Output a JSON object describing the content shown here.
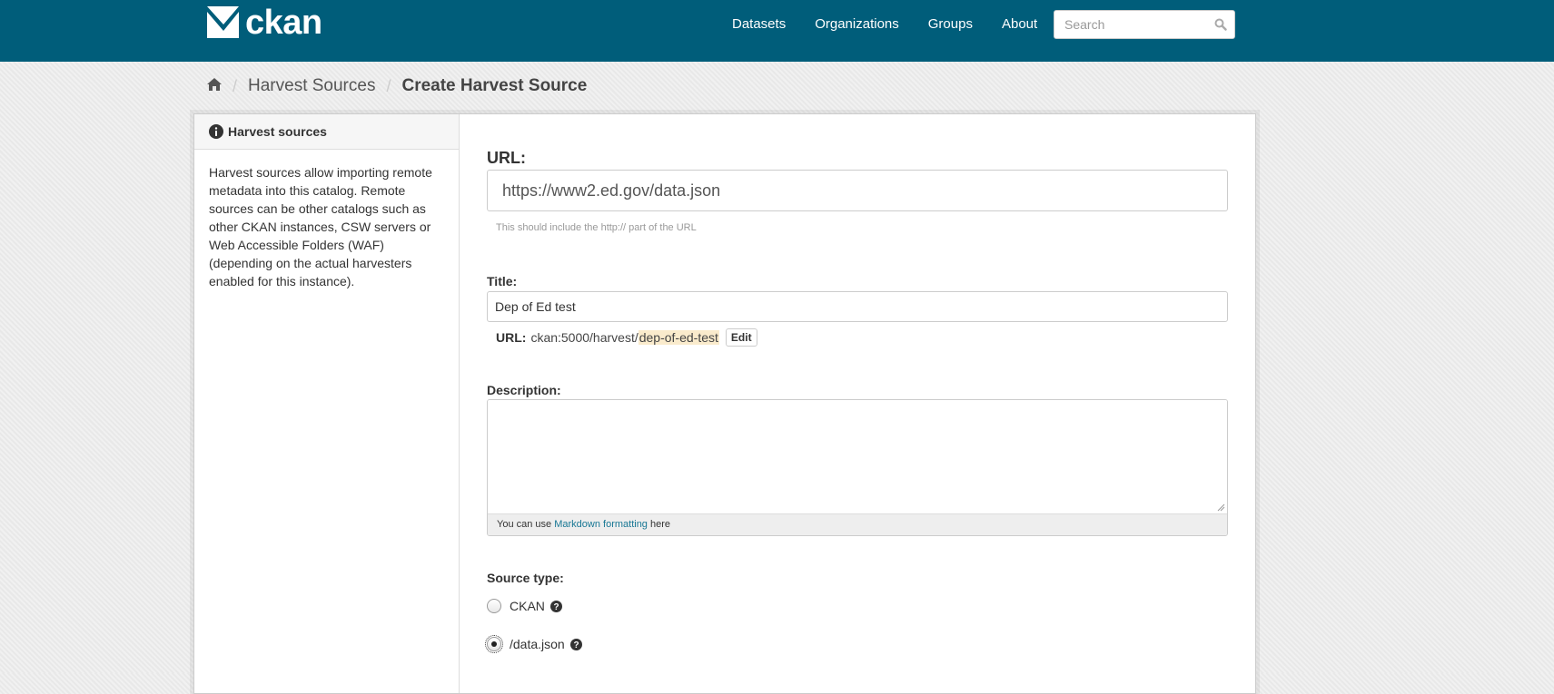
{
  "header": {
    "logo_text": "ckan",
    "nav": [
      "Datasets",
      "Organizations",
      "Groups",
      "About"
    ],
    "search_placeholder": "Search",
    "colors": {
      "masthead": "#005d7a",
      "link": "#187794"
    }
  },
  "breadcrumb": {
    "home_icon": "home-icon",
    "items": [
      "Harvest Sources",
      "Create Harvest Source"
    ]
  },
  "sidebar": {
    "title": "Harvest sources",
    "icon": "info-circle-icon",
    "body": "Harvest sources allow importing remote metadata into this catalog. Remote sources can be other catalogs such as other CKAN instances, CSW servers or Web Accessible Folders (WAF) (depending on the actual harvesters enabled for this instance)."
  },
  "form": {
    "url_label": "URL:",
    "url_value": "https://www2.ed.gov/data.json",
    "url_help": "This should include the http:// part of the URL",
    "title_label": "Title:",
    "title_value": "Dep of Ed test",
    "slug_label": "URL:",
    "slug_host": "ckan:5000/harvest/",
    "slug_value": "dep-of-ed-test",
    "edit_label": "Edit",
    "description_label": "Description:",
    "description_value": "",
    "markdown_prefix": "You can use",
    "markdown_link": "Markdown formatting",
    "markdown_suffix": "here",
    "source_type_label": "Source type:",
    "source_types": [
      {
        "label": "CKAN",
        "checked": false
      },
      {
        "label": "/data.json",
        "checked": true
      }
    ]
  }
}
